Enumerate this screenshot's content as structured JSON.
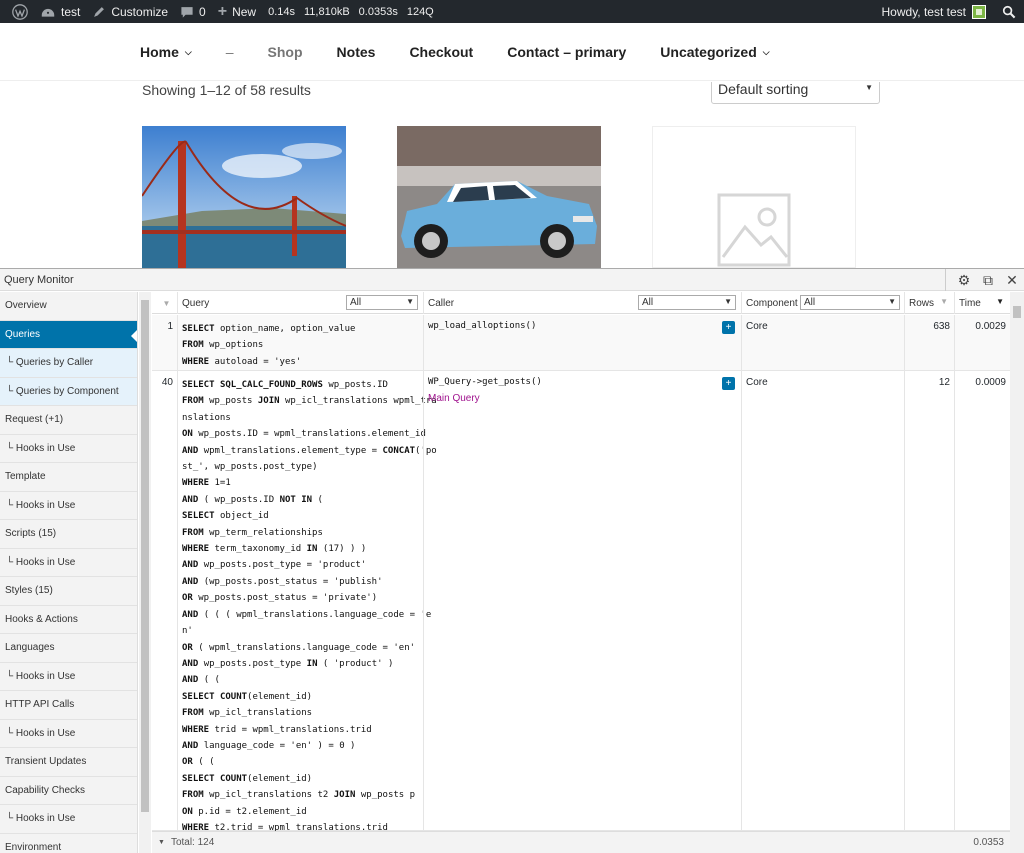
{
  "adminbar": {
    "site_name": "test",
    "customize": "Customize",
    "comments_count": "0",
    "new": "New",
    "qm_time": "0.14s",
    "qm_memory": "11,810kB",
    "qm_db_time": "0.0353s",
    "qm_queries": "124Q",
    "howdy": "Howdy, test test"
  },
  "nav": {
    "items": [
      {
        "label": "Home"
      },
      {
        "label": "–"
      },
      {
        "label": "Shop"
      },
      {
        "label": "Notes"
      },
      {
        "label": "Checkout"
      },
      {
        "label": "Contact – primary"
      },
      {
        "label": "Uncategorized"
      }
    ]
  },
  "shop": {
    "result_count": "Showing 1–12 of 58 results",
    "sorting": "Default sorting"
  },
  "qm": {
    "title": "Query Monitor",
    "nav": [
      {
        "label": "Overview"
      },
      {
        "label": "Queries"
      },
      {
        "label": "└ Queries by Caller"
      },
      {
        "label": "└ Queries by Component"
      },
      {
        "label": "Request (+1)"
      },
      {
        "label": "└ Hooks in Use"
      },
      {
        "label": "Template"
      },
      {
        "label": "└ Hooks in Use"
      },
      {
        "label": "Scripts (15)"
      },
      {
        "label": "└ Hooks in Use"
      },
      {
        "label": "Styles (15)"
      },
      {
        "label": "Hooks & Actions"
      },
      {
        "label": "Languages"
      },
      {
        "label": "└ Hooks in Use"
      },
      {
        "label": "HTTP API Calls"
      },
      {
        "label": "└ Hooks in Use"
      },
      {
        "label": "Transient Updates"
      },
      {
        "label": "Capability Checks"
      },
      {
        "label": "└ Hooks in Use"
      },
      {
        "label": "Environment"
      }
    ],
    "columns": {
      "query": "Query",
      "caller": "Caller",
      "component": "Component",
      "rows": "Rows",
      "time": "Time",
      "filter_all": "All"
    },
    "rows": [
      {
        "num": "1",
        "sql": [
          "SELECT option_name, option_value",
          "FROM wp_options",
          "WHERE autoload = 'yes'"
        ],
        "caller": "wp_load_alloptions()",
        "caller_note": "",
        "component": "Core",
        "rows": "638",
        "time": "0.0029"
      },
      {
        "num": "40",
        "sql": [
          "SELECT SQL_CALC_FOUND_ROWS wp_posts.ID",
          "FROM wp_posts JOIN wp_icl_translations wpml_tra",
          "nslations",
          "ON wp_posts.ID = wpml_translations.element_id",
          "AND wpml_translations.element_type = CONCAT('po",
          "st_', wp_posts.post_type)",
          "WHERE 1=1",
          "AND ( wp_posts.ID NOT IN (",
          "SELECT object_id",
          "FROM wp_term_relationships",
          "WHERE term_taxonomy_id IN (17) ) )",
          "AND wp_posts.post_type = 'product'",
          "AND (wp_posts.post_status = 'publish'",
          "OR wp_posts.post_status = 'private')",
          "AND ( ( ( wpml_translations.language_code = 'e",
          "n'",
          "OR ( wpml_translations.language_code = 'en'",
          "AND wp_posts.post_type IN ( 'product' )",
          "AND ( (",
          "SELECT COUNT(element_id)",
          "FROM wp_icl_translations",
          "WHERE trid = wpml_translations.trid",
          "AND language_code = 'en' ) = 0 )",
          "OR ( (",
          "SELECT COUNT(element_id)",
          "FROM wp_icl_translations t2 JOIN wp_posts p",
          "ON p.id = t2.element_id",
          "WHERE t2.trid = wpml_translations.trid"
        ],
        "caller": "WP_Query->get_posts()",
        "caller_note": "Main Query",
        "component": "Core",
        "rows": "12",
        "time": "0.0009"
      }
    ],
    "footer": {
      "total": "Total: 124",
      "total_time": "0.0353"
    }
  }
}
